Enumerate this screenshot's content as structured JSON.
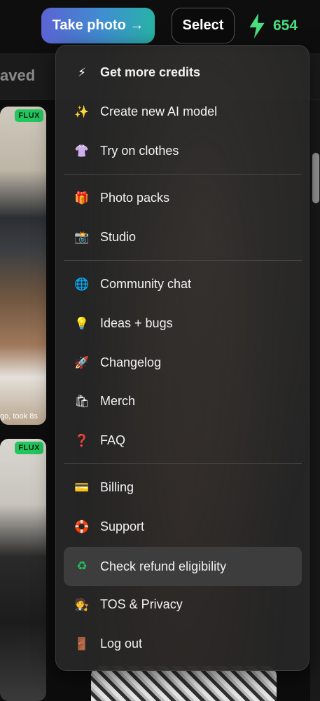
{
  "topbar": {
    "take_photo": "Take photo →",
    "select": "Select",
    "credits": "654"
  },
  "background": {
    "tab_partial": "aved",
    "badge1": "FLUX",
    "badge2": "FLUX",
    "caption": "go, took 8s"
  },
  "menu": {
    "items": [
      {
        "label": "Get more credits",
        "icon": "⚡"
      },
      {
        "label": "Create new AI model",
        "icon": "✨"
      },
      {
        "label": "Try on clothes",
        "icon": "👚"
      },
      {
        "label": "Photo packs",
        "icon": "🎁"
      },
      {
        "label": "Studio",
        "icon": "📸"
      },
      {
        "label": "Community chat",
        "icon": "🌐"
      },
      {
        "label": "Ideas + bugs",
        "icon": "💡"
      },
      {
        "label": "Changelog",
        "icon": "🚀"
      },
      {
        "label": "Merch",
        "icon": "🛍"
      },
      {
        "label": "FAQ",
        "icon": "❓"
      },
      {
        "label": "Billing",
        "icon": "💳"
      },
      {
        "label": "Support",
        "icon": "🛟"
      },
      {
        "label": "Check refund eligibility",
        "icon": "♻"
      },
      {
        "label": "TOS & Privacy",
        "icon": "🧑‍⚖️"
      },
      {
        "label": "Log out",
        "icon": "🚪"
      }
    ]
  },
  "colors": {
    "credits_green": "#4ade80",
    "flux_badge": "#22c55e",
    "menu_bg": "#262626",
    "highlight": "#3d3d3d"
  }
}
